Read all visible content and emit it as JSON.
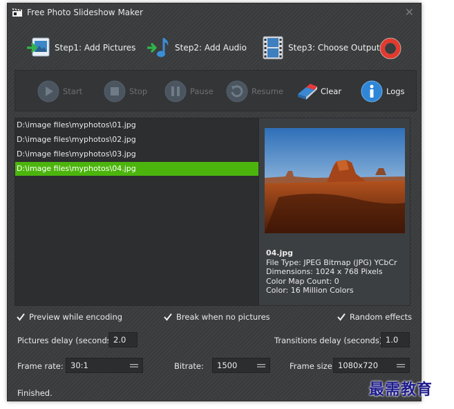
{
  "window": {
    "title": "Free Photo Slideshow Maker"
  },
  "steps": [
    {
      "label": "Step1: Add Pictures",
      "icon": "add-pictures-icon"
    },
    {
      "label": "Step2: Add Audio",
      "icon": "add-audio-icon"
    },
    {
      "label": "Step3: Choose Output",
      "icon": "film-strip-icon"
    }
  ],
  "help_icon": "life-ring-icon",
  "toolbar": {
    "start": "Start",
    "stop": "Stop",
    "pause": "Pause",
    "resume": "Resume",
    "clear": "Clear",
    "logs": "Logs"
  },
  "files": [
    "D:\\image files\\myphotos\\01.jpg",
    "D:\\image files\\myphotos\\02.jpg",
    "D:\\image files\\myphotos\\03.jpg",
    "D:\\image files\\myphotos\\04.jpg"
  ],
  "selected_file_index": 3,
  "preview": {
    "name": "04.jpg",
    "file_type": "File Type: JPEG Bitmap (JPG) YCbCr",
    "dimensions": "Dimensions: 1024 x 768 Pixels",
    "color_map": "Color Map Count: 0",
    "color": "Color: 16 Million Colors"
  },
  "options": {
    "preview_while_encoding": {
      "label": "Preview while encoding",
      "checked": true
    },
    "break_when_no_pictures": {
      "label": "Break when no pictures",
      "checked": true
    },
    "random_effects": {
      "label": "Random effects",
      "checked": true
    }
  },
  "settings": {
    "pictures_delay_label": "Pictures delay (seconds)",
    "pictures_delay_value": "2.0",
    "transitions_delay_label": "Transitions delay (seconds)",
    "transitions_delay_value": "1.0",
    "frame_rate_label": "Frame rate:",
    "frame_rate_value": "30:1",
    "bitrate_label": "Bitrate:",
    "bitrate_value": "1500",
    "frame_size_label": "Frame size:",
    "frame_size_value": "1080x720"
  },
  "status": "Finished.",
  "watermark": "最需教育",
  "colors": {
    "selection": "#4cb50d",
    "window_bg": "#3a3c3e",
    "watermark": "#1e1c8c"
  }
}
